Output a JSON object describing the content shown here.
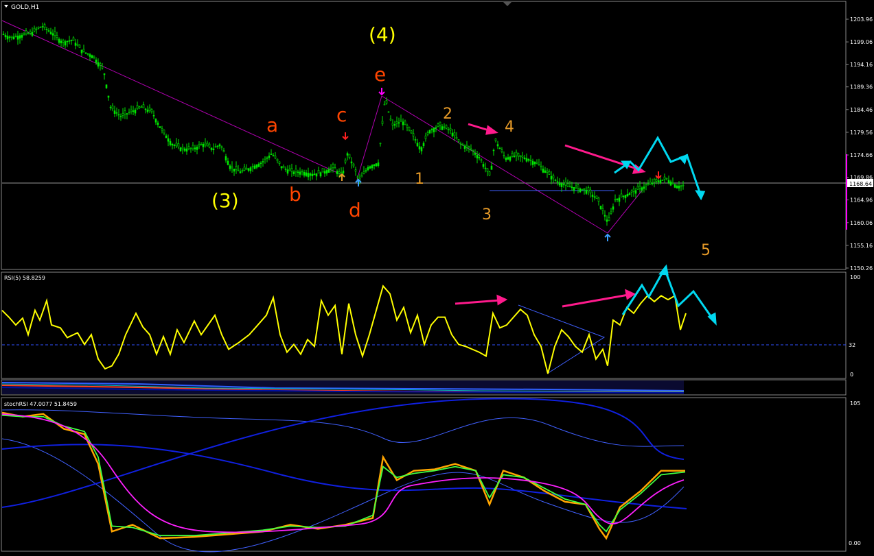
{
  "window": {
    "symbol_label": "GOLD,H1"
  },
  "colors": {
    "background": "#000000",
    "grid_border": "#ffffff",
    "candle": "#00e600",
    "rsi": "#ffff00",
    "wave_yellow": "#ffff00",
    "wave_red": "#ff4500",
    "wave_orange": "#e69a28",
    "trendline": "#b000b0",
    "cyan_arrow": "#00d8f0",
    "magenta_arrow": "#ff1a8c",
    "blue_line": "#2030ff",
    "stoch_orange": "#ffa500",
    "stoch_green": "#40ff40",
    "stoch_magenta": "#ff20ff"
  },
  "price_panel": {
    "axis_labels": [
      "1203.96",
      "1199.06",
      "1194.16",
      "1189.36",
      "1184.46",
      "1179.56",
      "1174.66",
      "1169.86",
      "1164.96",
      "1160.06",
      "1155.16",
      "1150.26"
    ],
    "current_price": "1168.64",
    "wave_labels": [
      {
        "text": "(4)",
        "color": "yellow"
      },
      {
        "text": "e",
        "color": "red"
      },
      {
        "text": "c",
        "color": "red"
      },
      {
        "text": "a",
        "color": "red"
      },
      {
        "text": "b",
        "color": "red"
      },
      {
        "text": "d",
        "color": "red"
      },
      {
        "text": "(3)",
        "color": "yellow"
      },
      {
        "text": "1",
        "color": "orange"
      },
      {
        "text": "2",
        "color": "orange"
      },
      {
        "text": "3",
        "color": "orange"
      },
      {
        "text": "4",
        "color": "orange"
      },
      {
        "text": "5",
        "color": "orange"
      }
    ]
  },
  "rsi_panel": {
    "title": "RSI(5) 58.8259",
    "axis_labels": [
      "100",
      "32",
      "0"
    ]
  },
  "stoch_panel": {
    "title": "stochRSI 47.0077 51.8459",
    "axis_labels": [
      "105",
      "0.00"
    ]
  },
  "chart_data": [
    {
      "type": "candlestick",
      "title": "GOLD,H1",
      "ylim": [
        1150.26,
        1203.96
      ],
      "close_path": [
        [
          0,
          1201
        ],
        [
          15,
          1200
        ],
        [
          30,
          1200.5
        ],
        [
          45,
          1201
        ],
        [
          60,
          1202.5
        ],
        [
          75,
          1201
        ],
        [
          90,
          1199
        ],
        [
          105,
          1199.5
        ],
        [
          120,
          1197
        ],
        [
          135,
          1196
        ],
        [
          150,
          1193
        ],
        [
          160,
          1185
        ],
        [
          175,
          1183
        ],
        [
          190,
          1184
        ],
        [
          205,
          1185
        ],
        [
          220,
          1184
        ],
        [
          235,
          1180
        ],
        [
          250,
          1177
        ],
        [
          265,
          1176
        ],
        [
          280,
          1176
        ],
        [
          295,
          1177
        ],
        [
          310,
          1176
        ],
        [
          320,
          1177
        ],
        [
          335,
          1172
        ],
        [
          350,
          1171
        ],
        [
          365,
          1172
        ],
        [
          380,
          1173
        ],
        [
          395,
          1175
        ],
        [
          410,
          1172
        ],
        [
          425,
          1171
        ],
        [
          440,
          1171
        ],
        [
          455,
          1170.5
        ],
        [
          470,
          1171
        ],
        [
          485,
          1172
        ],
        [
          497,
          1170
        ],
        [
          505,
          1175
        ],
        [
          515,
          1172
        ],
        [
          522,
          1169
        ],
        [
          535,
          1172
        ],
        [
          550,
          1173
        ],
        [
          560,
          1187
        ],
        [
          570,
          1181
        ],
        [
          585,
          1182
        ],
        [
          600,
          1179
        ],
        [
          612,
          1176
        ],
        [
          625,
          1180
        ],
        [
          640,
          1181
        ],
        [
          655,
          1180
        ],
        [
          670,
          1177
        ],
        [
          685,
          1176
        ],
        [
          698,
          1174
        ],
        [
          713,
          1170
        ],
        [
          720,
          1178
        ],
        [
          735,
          1174
        ],
        [
          750,
          1174.5
        ],
        [
          765,
          1174
        ],
        [
          780,
          1173
        ],
        [
          795,
          1171
        ],
        [
          810,
          1169
        ],
        [
          825,
          1168
        ],
        [
          840,
          1167.5
        ],
        [
          855,
          1167
        ],
        [
          870,
          1165
        ],
        [
          885,
          1160
        ],
        [
          895,
          1165
        ],
        [
          910,
          1166
        ],
        [
          925,
          1167
        ],
        [
          940,
          1168
        ],
        [
          955,
          1169
        ],
        [
          970,
          1169.5
        ],
        [
          985,
          1168
        ],
        [
          995,
          1168
        ]
      ]
    },
    {
      "type": "line",
      "title": "RSI(5) 58.8259",
      "ylim": [
        0,
        100
      ],
      "level": 32,
      "series": [
        {
          "values": [
            [
              0,
              65
            ],
            [
              10,
              58
            ],
            [
              20,
              50
            ],
            [
              30,
              57
            ],
            [
              38,
              40
            ],
            [
              48,
              65
            ],
            [
              55,
              55
            ],
            [
              65,
              75
            ],
            [
              72,
              50
            ],
            [
              85,
              47
            ],
            [
              95,
              37
            ],
            [
              110,
              42
            ],
            [
              120,
              30
            ],
            [
              130,
              40
            ],
            [
              140,
              15
            ],
            [
              150,
              5
            ],
            [
              160,
              8
            ],
            [
              170,
              20
            ],
            [
              180,
              40
            ],
            [
              195,
              62
            ],
            [
              205,
              48
            ],
            [
              215,
              40
            ],
            [
              225,
              20
            ],
            [
              235,
              38
            ],
            [
              245,
              20
            ],
            [
              255,
              45
            ],
            [
              265,
              32
            ],
            [
              280,
              54
            ],
            [
              290,
              40
            ],
            [
              300,
              50
            ],
            [
              310,
              60
            ],
            [
              320,
              40
            ],
            [
              330,
              25
            ],
            [
              345,
              32
            ],
            [
              360,
              40
            ],
            [
              375,
              52
            ],
            [
              385,
              60
            ],
            [
              395,
              78
            ],
            [
              405,
              40
            ],
            [
              415,
              22
            ],
            [
              425,
              30
            ],
            [
              435,
              20
            ],
            [
              445,
              35
            ],
            [
              455,
              28
            ],
            [
              465,
              75
            ],
            [
              475,
              60
            ],
            [
              485,
              70
            ],
            [
              495,
              20
            ],
            [
              505,
              72
            ],
            [
              515,
              40
            ],
            [
              525,
              18
            ],
            [
              535,
              40
            ],
            [
              545,
              65
            ],
            [
              555,
              90
            ],
            [
              565,
              82
            ],
            [
              575,
              55
            ],
            [
              585,
              68
            ],
            [
              595,
              42
            ],
            [
              605,
              60
            ],
            [
              615,
              30
            ],
            [
              625,
              50
            ],
            [
              635,
              58
            ],
            [
              645,
              58
            ],
            [
              655,
              40
            ],
            [
              665,
              30
            ],
            [
              675,
              28
            ],
            [
              685,
              25
            ],
            [
              695,
              22
            ],
            [
              705,
              18
            ],
            [
              715,
              62
            ],
            [
              725,
              47
            ],
            [
              735,
              50
            ],
            [
              745,
              58
            ],
            [
              755,
              66
            ],
            [
              765,
              60
            ],
            [
              775,
              40
            ],
            [
              785,
              28
            ],
            [
              795,
              0
            ],
            [
              805,
              28
            ],
            [
              815,
              45
            ],
            [
              825,
              38
            ],
            [
              835,
              28
            ],
            [
              845,
              22
            ],
            [
              855,
              40
            ],
            [
              865,
              15
            ],
            [
              875,
              25
            ],
            [
              882,
              8
            ],
            [
              890,
              55
            ],
            [
              900,
              50
            ],
            [
              910,
              68
            ],
            [
              920,
              62
            ],
            [
              930,
              72
            ],
            [
              940,
              80
            ],
            [
              950,
              74
            ],
            [
              960,
              80
            ],
            [
              970,
              76
            ],
            [
              980,
              80
            ],
            [
              988,
              45
            ],
            [
              996,
              62
            ]
          ]
        }
      ]
    },
    {
      "type": "line",
      "title": "stochRSI 47.0077 51.8459",
      "ylim": [
        0,
        105
      ],
      "series": [
        {
          "name": "stochRSI",
          "values": [
            [
              0,
              98
            ],
            [
              30,
              95
            ],
            [
              60,
              97
            ],
            [
              90,
              86
            ],
            [
              120,
              82
            ],
            [
              140,
              60
            ],
            [
              160,
              10
            ],
            [
              190,
              15
            ],
            [
              230,
              5
            ],
            [
              280,
              6
            ],
            [
              330,
              8
            ],
            [
              380,
              10
            ],
            [
              420,
              15
            ],
            [
              460,
              12
            ],
            [
              500,
              15
            ],
            [
              540,
              20
            ],
            [
              555,
              65
            ],
            [
              575,
              48
            ],
            [
              600,
              55
            ],
            [
              630,
              56
            ],
            [
              660,
              60
            ],
            [
              690,
              55
            ],
            [
              710,
              30
            ],
            [
              730,
              55
            ],
            [
              760,
              50
            ],
            [
              790,
              40
            ],
            [
              820,
              32
            ],
            [
              850,
              30
            ],
            [
              870,
              12
            ],
            [
              880,
              5
            ],
            [
              900,
              28
            ],
            [
              930,
              40
            ],
            [
              960,
              55
            ],
            [
              995,
              55
            ]
          ]
        },
        {
          "name": "signal",
          "values": [
            [
              0,
              96
            ],
            [
              30,
              95
            ],
            [
              60,
              95
            ],
            [
              90,
              88
            ],
            [
              120,
              84
            ],
            [
              140,
              65
            ],
            [
              160,
              14
            ],
            [
              190,
              13
            ],
            [
              230,
              7
            ],
            [
              280,
              7
            ],
            [
              330,
              9
            ],
            [
              380,
              11
            ],
            [
              420,
              14
            ],
            [
              460,
              13
            ],
            [
              500,
              14
            ],
            [
              540,
              22
            ],
            [
              555,
              58
            ],
            [
              575,
              50
            ],
            [
              600,
              53
            ],
            [
              630,
              55
            ],
            [
              660,
              58
            ],
            [
              690,
              55
            ],
            [
              710,
              35
            ],
            [
              730,
              52
            ],
            [
              760,
              50
            ],
            [
              790,
              42
            ],
            [
              820,
              34
            ],
            [
              850,
              30
            ],
            [
              870,
              15
            ],
            [
              880,
              10
            ],
            [
              900,
              26
            ],
            [
              930,
              38
            ],
            [
              960,
              52
            ],
            [
              995,
              54
            ]
          ]
        }
      ]
    }
  ]
}
